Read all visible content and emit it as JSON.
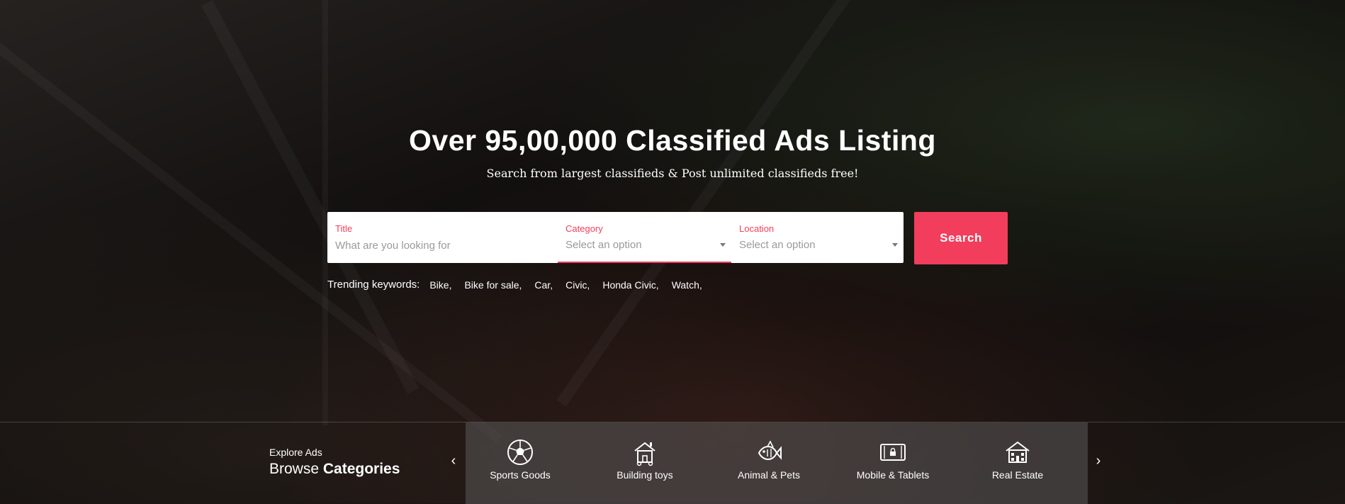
{
  "hero": {
    "headline": "Over 95,00,000 Classified Ads Listing",
    "subline": "Search from largest classifieds & Post unlimited classifieds free!"
  },
  "search": {
    "title_label": "Title",
    "title_placeholder": "What are you looking for",
    "category_label": "Category",
    "category_value": "Select an option",
    "location_label": "Location",
    "location_value": "Select an option",
    "button_label": "Search"
  },
  "trending": {
    "label": "Trending keywords:",
    "keywords": [
      "Bike,",
      "Bike for sale,",
      "Car,",
      "Civic,",
      "Honda Civic,",
      "Watch,"
    ]
  },
  "categories": {
    "kicker": "Explore Ads",
    "title_plain": "Browse",
    "title_bold": "Categories",
    "prev_arrow": "‹",
    "next_arrow": "›",
    "items": [
      {
        "label": "Sports Goods",
        "icon": "soccer-ball-icon"
      },
      {
        "label": "Building toys",
        "icon": "toy-house-icon"
      },
      {
        "label": "Animal & Pets",
        "icon": "fish-icon"
      },
      {
        "label": "Mobile & Tablets",
        "icon": "tablet-icon"
      },
      {
        "label": "Real Estate",
        "icon": "building-icon"
      }
    ]
  },
  "colors": {
    "accent": "#f23d5c"
  }
}
